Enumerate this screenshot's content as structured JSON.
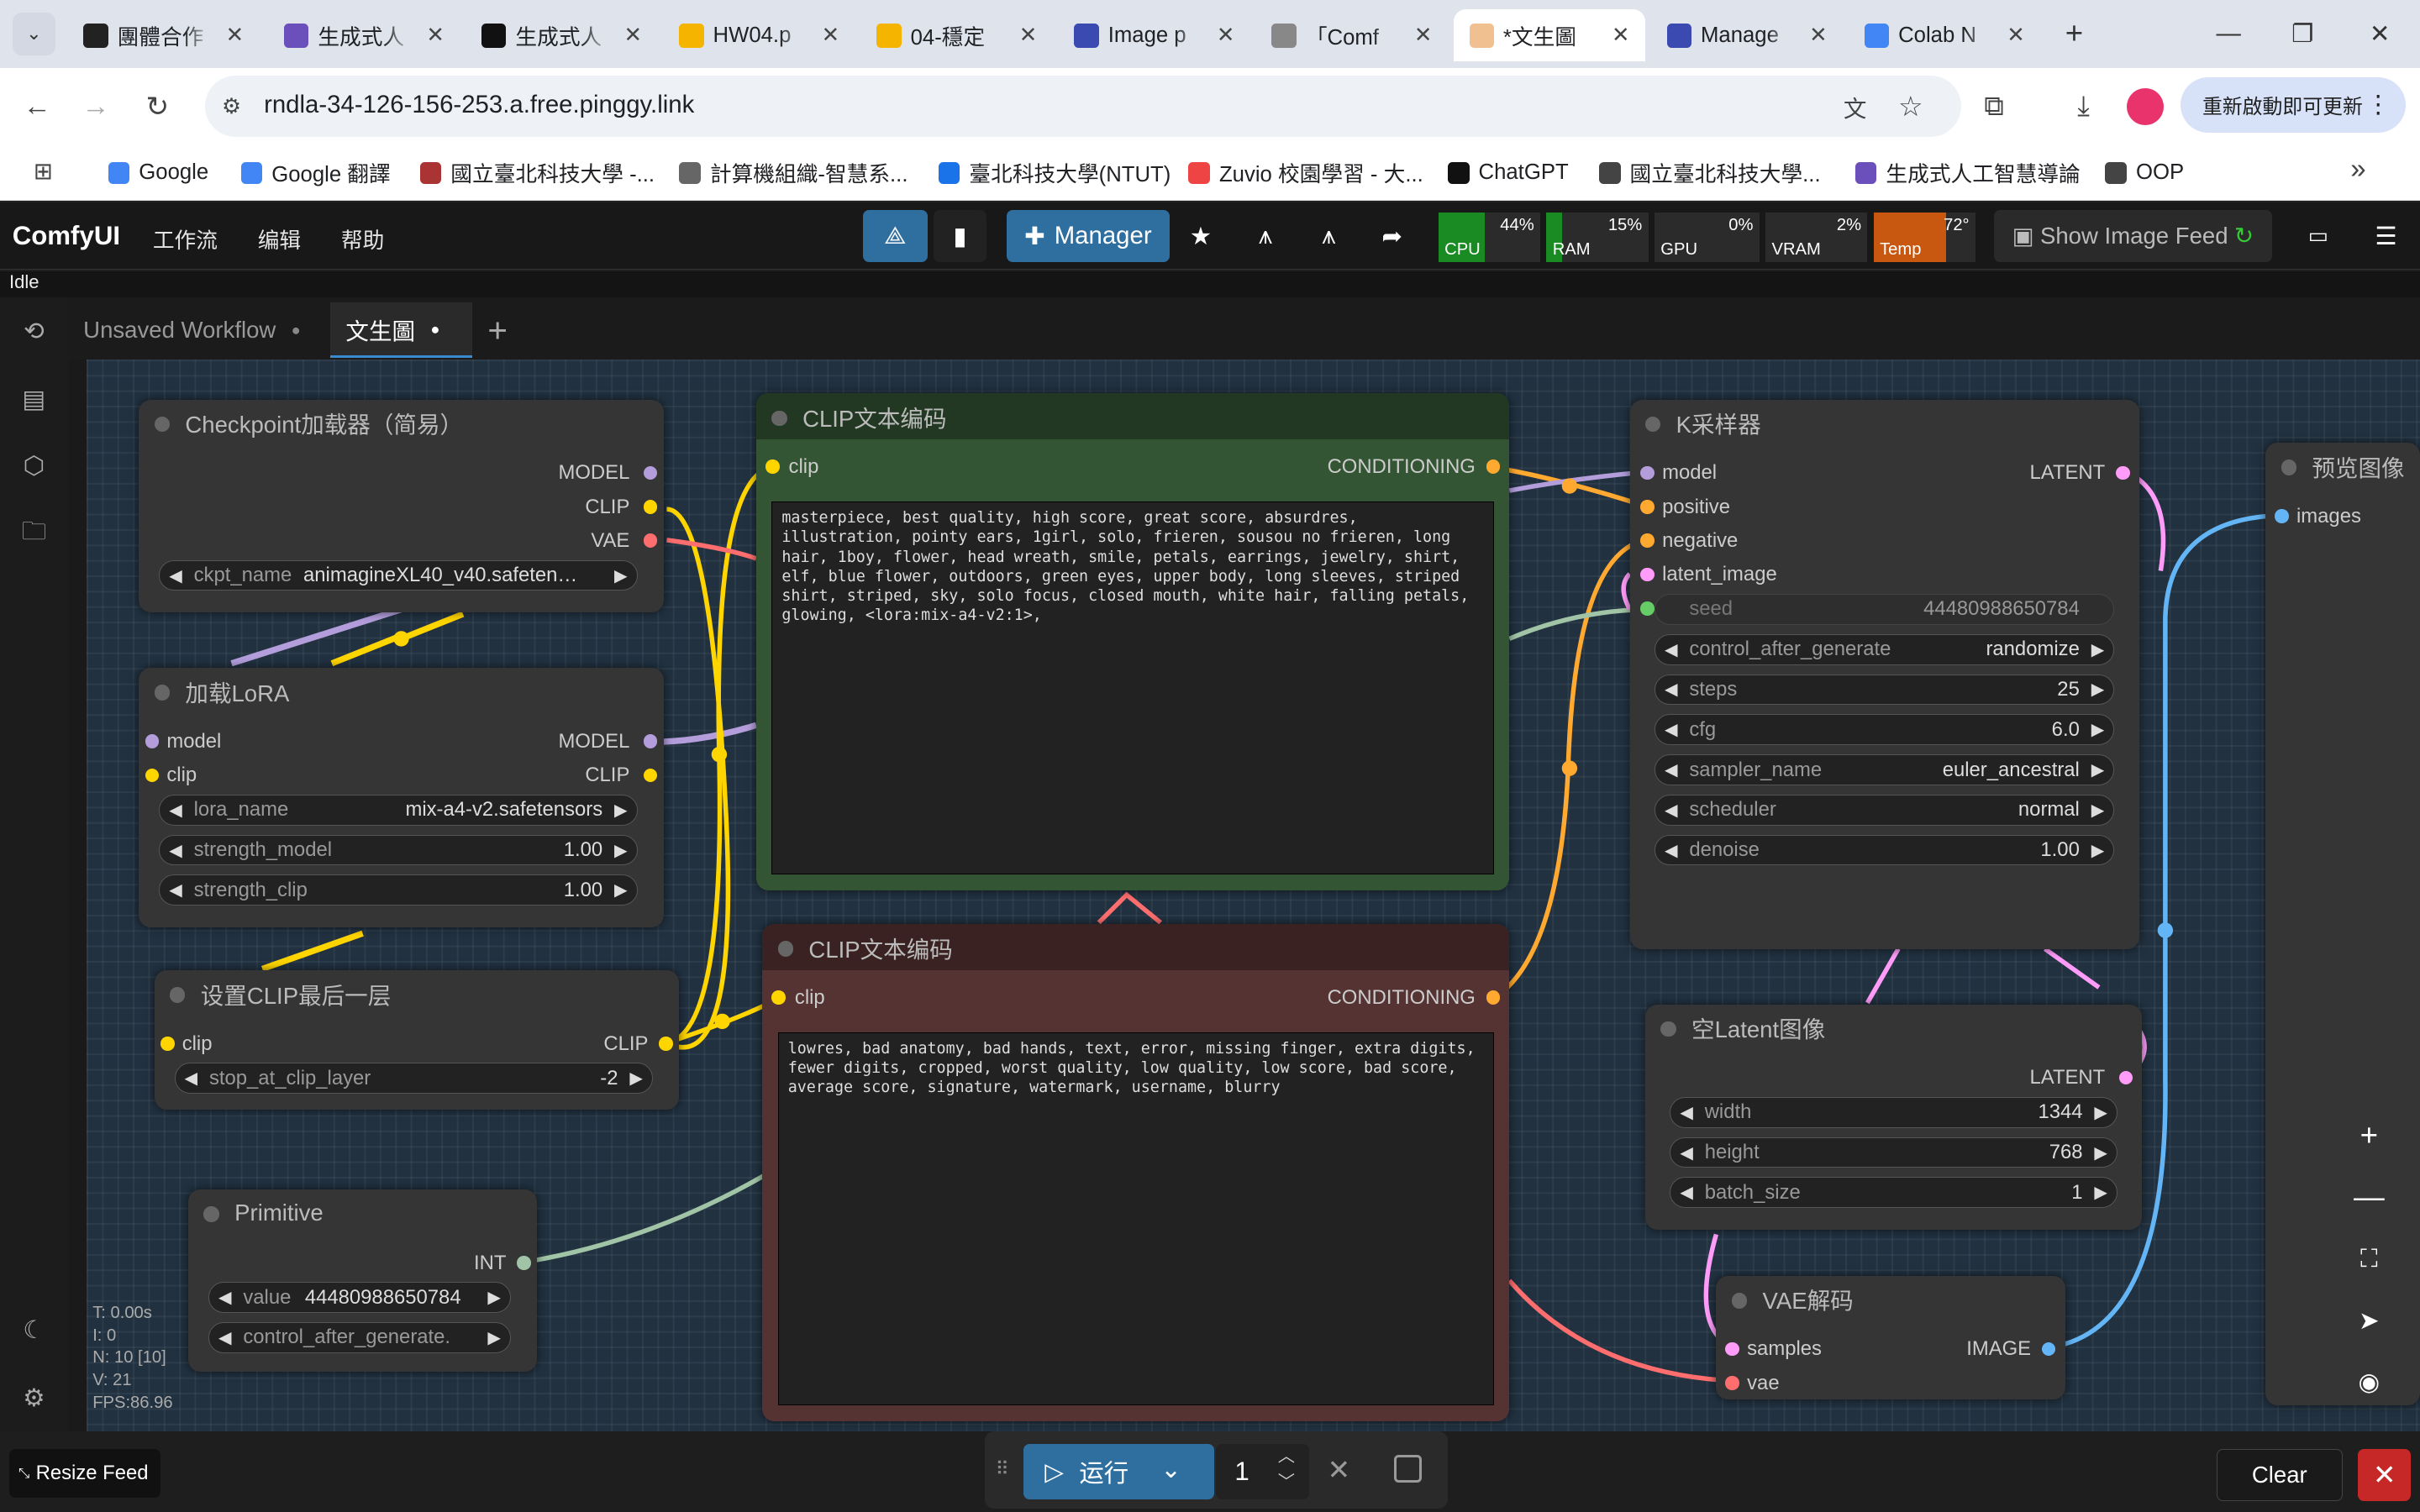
{
  "browser": {
    "tabs": [
      {
        "title": "團體合作",
        "color": "#222"
      },
      {
        "title": "生成式人",
        "color": "#6b4fbb"
      },
      {
        "title": "生成式人",
        "color": "#111"
      },
      {
        "title": "HW04.p",
        "color": "#f4b400"
      },
      {
        "title": "04-穩定",
        "color": "#f4b400"
      },
      {
        "title": "Image p",
        "color": "#3b4ab0"
      },
      {
        "title": "「Comf",
        "color": "#888"
      },
      {
        "title": "*文生圖",
        "color": "#f0c090"
      },
      {
        "title": "Manage",
        "color": "#3b4ab0"
      },
      {
        "title": "Colab N",
        "color": "#4285f4"
      }
    ],
    "url": "rndla-34-126-156-253.a.free.pinggy.link",
    "update_button": "重新啟動即可更新",
    "bookmarks": [
      "Google",
      "Google 翻譯",
      "國立臺北科技大學 -...",
      "計算機組織-智慧系...",
      "臺北科技大學(NTUT)",
      "Zuvio 校園學習 - 大...",
      "ChatGPT",
      "國立臺北科技大學...",
      "生成式人工智慧導論",
      "OOP"
    ]
  },
  "app": {
    "logo": "ComfyUI",
    "menu": [
      "工作流",
      "编辑",
      "帮助"
    ],
    "manager_label": "Manager",
    "show_feed": "Show Image Feed",
    "status": "Idle",
    "stats": {
      "cpu_label": "CPU",
      "cpu": "44%",
      "ram_label": "RAM",
      "ram": "15%",
      "gpu_label": "GPU",
      "gpu": "0%",
      "vram_label": "VRAM",
      "vram": "2%",
      "temp_label": "Temp",
      "temp": "72°"
    },
    "workflow_tabs": [
      "Unsaved Workflow",
      "文生圖"
    ]
  },
  "nodes": {
    "checkpoint": {
      "title": "Checkpoint加载器（简易）",
      "outputs": [
        "MODEL",
        "CLIP",
        "VAE"
      ],
      "ckpt_label": "ckpt_name",
      "ckpt_value": "animagineXL40_v40.safeten…"
    },
    "lora": {
      "title": "加载LoRA",
      "in_model": "model",
      "in_clip": "clip",
      "out_model": "MODEL",
      "out_clip": "CLIP",
      "lora_label": "lora_name",
      "lora_value": "mix-a4-v2.safetensors",
      "sm_label": "strength_model",
      "sm_value": "1.00",
      "sc_label": "strength_clip",
      "sc_value": "1.00"
    },
    "clipskip": {
      "title": "设置CLIP最后一层",
      "in_clip": "clip",
      "out_clip": "CLIP",
      "stop_label": "stop_at_clip_layer",
      "stop_value": "-2"
    },
    "primitive": {
      "title": "Primitive",
      "out": "INT",
      "value_label": "value",
      "value": "44480988650784",
      "cag_label": "control_after_generate."
    },
    "clip_pos": {
      "title": "CLIP文本编码",
      "in_clip": "clip",
      "out": "CONDITIONING",
      "text": "masterpiece, best quality, high score, great score, absurdres, illustration, pointy ears, 1girl, solo, frieren, sousou no frieren, long hair, 1boy, flower, head wreath, smile, petals, earrings, jewelry, shirt, elf, blue flower, outdoors, green eyes, upper body, long sleeves, striped shirt, striped, sky, solo focus, closed mouth, white hair, falling petals, glowing, <lora:mix-a4-v2:1>,"
    },
    "clip_neg": {
      "title": "CLIP文本编码",
      "in_clip": "clip",
      "out": "CONDITIONING",
      "text": "lowres, bad anatomy, bad hands, text, error, missing finger, extra digits, fewer digits, cropped, worst quality, low quality, low score, bad score, average score, signature, watermark, username, blurry"
    },
    "ksampler": {
      "title": "K采样器",
      "inputs": [
        "model",
        "positive",
        "negative",
        "latent_image"
      ],
      "out": "LATENT",
      "seed_label": "seed",
      "seed_value": "44480988650784",
      "widgets": [
        {
          "label": "control_after_generate",
          "value": "randomize"
        },
        {
          "label": "steps",
          "value": "25"
        },
        {
          "label": "cfg",
          "value": "6.0"
        },
        {
          "label": "sampler_name",
          "value": "euler_ancestral"
        },
        {
          "label": "scheduler",
          "value": "normal"
        },
        {
          "label": "denoise",
          "value": "1.00"
        }
      ]
    },
    "latent": {
      "title": "空Latent图像",
      "out": "LATENT",
      "widgets": [
        {
          "label": "width",
          "value": "1344"
        },
        {
          "label": "height",
          "value": "768"
        },
        {
          "label": "batch_size",
          "value": "1"
        }
      ]
    },
    "vaedecode": {
      "title": "VAE解码",
      "in_samples": "samples",
      "in_vae": "vae",
      "out": "IMAGE"
    },
    "preview": {
      "title": "预览图像",
      "in_images": "images"
    }
  },
  "canvas_stats": [
    "T: 0.00s",
    "I: 0",
    "N: 10 [10]",
    "V: 21",
    "FPS:86.96"
  ],
  "bottom": {
    "resize_feed": "Resize Feed",
    "run_label": "运行",
    "batch_count": "1",
    "clear_label": "Clear"
  },
  "colors": {
    "model": "#b39ddb",
    "clip": "#ffd500",
    "vae": "#ff6e6e",
    "conditioning": "#ffa931",
    "latent": "#ff9cf9",
    "image": "#64b5f6",
    "int": "#a1c4a6"
  }
}
